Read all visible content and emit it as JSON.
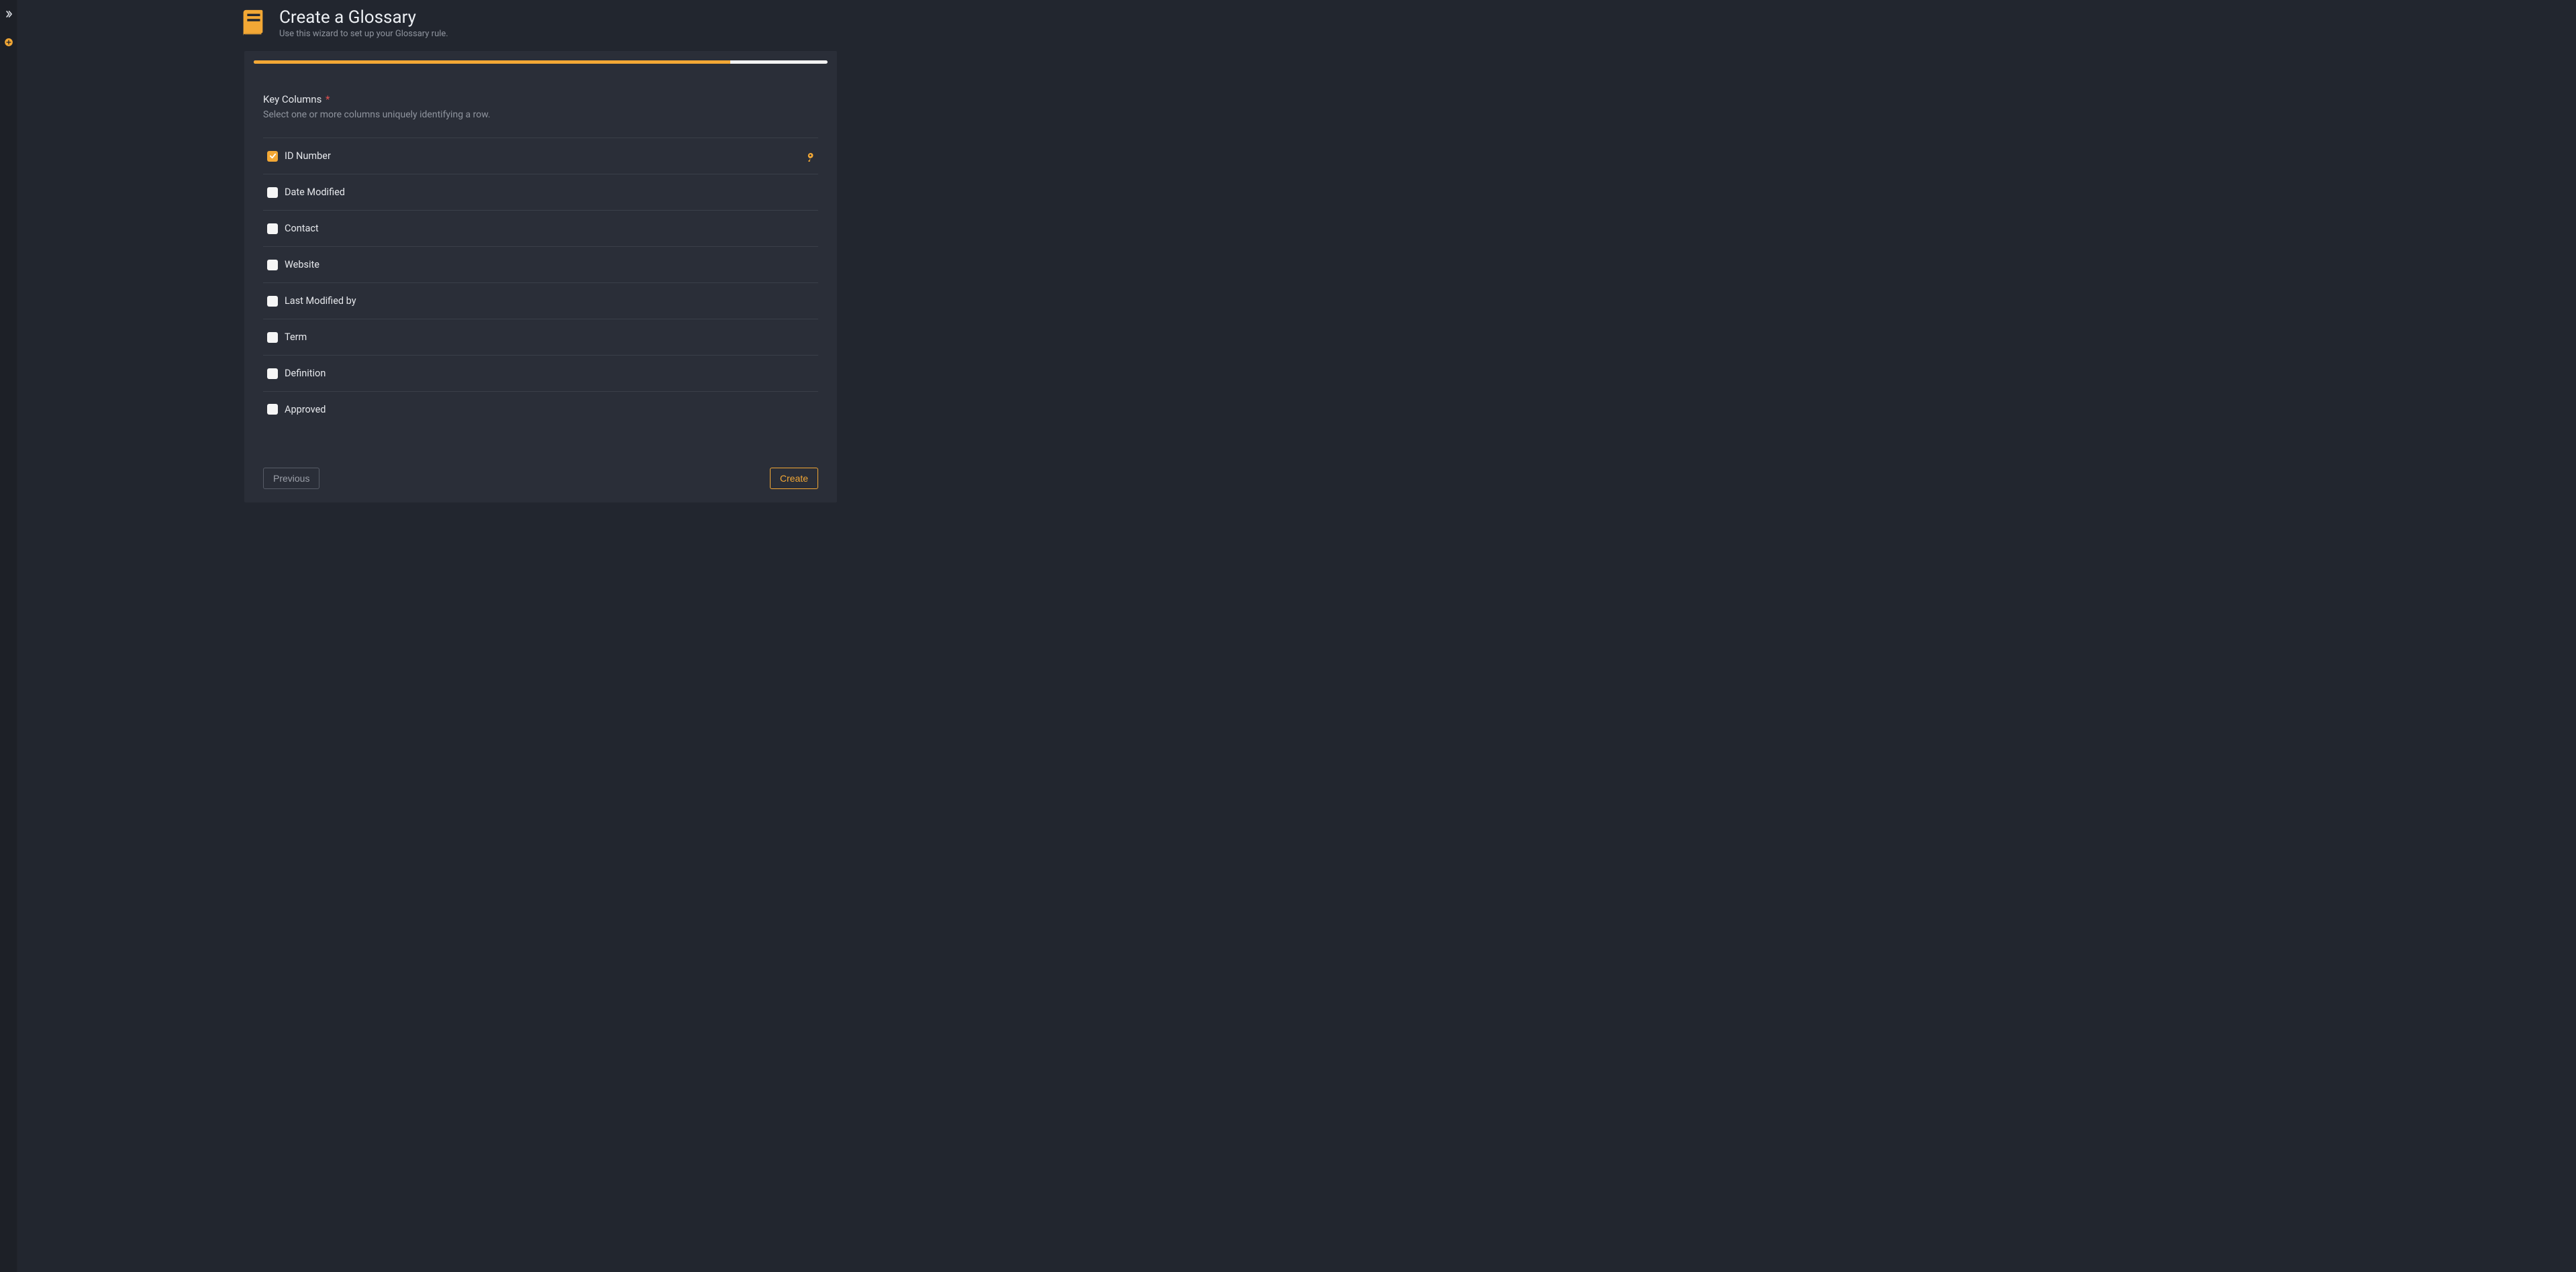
{
  "header": {
    "title": "Create a Glossary",
    "subtitle": "Use this wizard to set up your Glossary rule."
  },
  "progress": {
    "percent": 83
  },
  "section": {
    "title": "Key Columns",
    "required_marker": "*",
    "subtitle": "Select one or more columns uniquely identifying a row."
  },
  "columns": [
    {
      "label": "ID Number",
      "checked": true,
      "is_key": true
    },
    {
      "label": "Date Modified",
      "checked": false,
      "is_key": false
    },
    {
      "label": "Contact",
      "checked": false,
      "is_key": false
    },
    {
      "label": "Website",
      "checked": false,
      "is_key": false
    },
    {
      "label": "Last Modified by",
      "checked": false,
      "is_key": false
    },
    {
      "label": "Term",
      "checked": false,
      "is_key": false
    },
    {
      "label": "Definition",
      "checked": false,
      "is_key": false
    },
    {
      "label": "Approved",
      "checked": false,
      "is_key": false
    }
  ],
  "footer": {
    "previous_label": "Previous",
    "create_label": "Create"
  }
}
